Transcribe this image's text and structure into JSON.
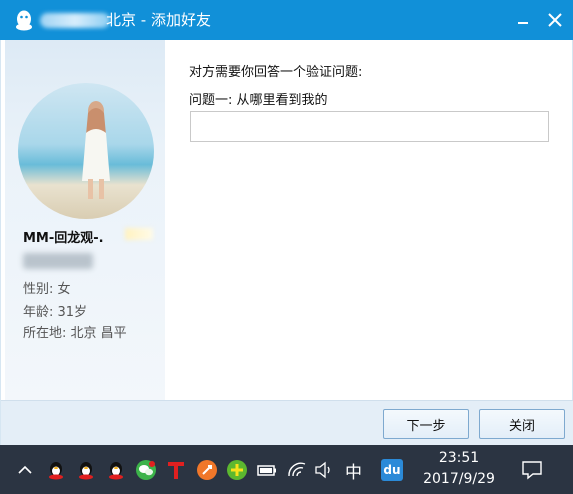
{
  "window": {
    "title": "北京 - 添加好友",
    "colors": {
      "titlebar": "#1190d8",
      "taskbar": "#2b3442"
    }
  },
  "titlebar_buttons": {
    "minimize_icon": "minimize-icon",
    "close_icon": "close-icon"
  },
  "profile": {
    "nickname": "MM-回龙观-.",
    "gender": "性别: 女",
    "age": "年龄: 31岁",
    "location": "所在地: 北京  昌平"
  },
  "verification": {
    "prompt": "对方需要你回答一个验证问题:",
    "question": "问题一: 从哪里看到我的",
    "answer_value": ""
  },
  "footer": {
    "next_label": "下一步",
    "close_label": "关闭"
  },
  "taskbar": {
    "ime_label": "中",
    "baidu_label": "du",
    "time": "23:51",
    "date": "2017/9/29"
  }
}
